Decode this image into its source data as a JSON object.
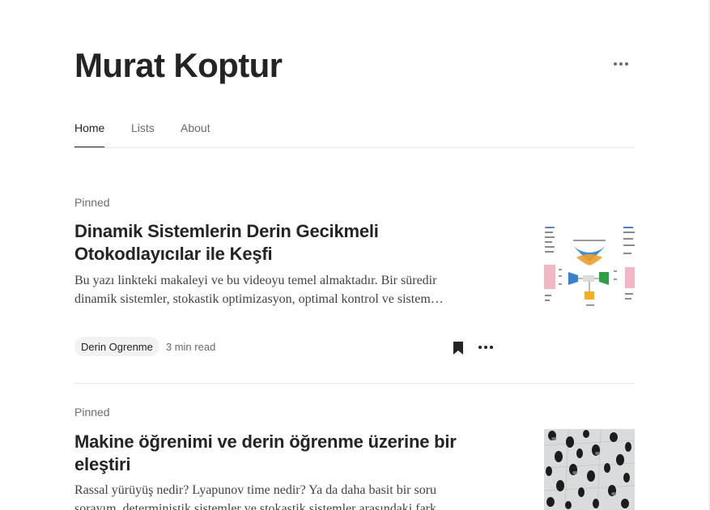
{
  "profile": {
    "name": "Murat Koptur",
    "more_icon": "more-horizontal-icon"
  },
  "tabs": [
    {
      "label": "Home",
      "active": true
    },
    {
      "label": "Lists",
      "active": false
    },
    {
      "label": "About",
      "active": false
    }
  ],
  "articles": [
    {
      "pinned_label": "Pinned",
      "title": "Dinamik Sistemlerin Derin Gecikmeli Otokodlayıcılar ile Keşfi",
      "excerpt": "Bu yazı linkteki makaleyi ve bu videoyu temel almaktadır. Bir süredir dinamik sistemler, stokastik optimizasyon, optimal kontrol ve sistem…",
      "tag": "Derin Ogrenme",
      "read_time": "3 min read",
      "thumbnail": "autoencoder-diagram-image",
      "bookmarked": true
    },
    {
      "pinned_label": "Pinned",
      "title": "Makine öğrenimi ve derin öğrenme üzerine bir eleştiri",
      "excerpt": "Rassal yürüyüş nedir? Lyapunov time nedir? Ya da daha basit bir soru sorayım, deterministik sistemler ve stokastik sistemler arasındaki fark…",
      "thumbnail": "crowd-aerial-photo"
    }
  ],
  "colors": {
    "text": "#242424",
    "muted": "#6b6b6b",
    "divider": "#e6e6e6",
    "chip_bg": "#f2f2f2"
  }
}
